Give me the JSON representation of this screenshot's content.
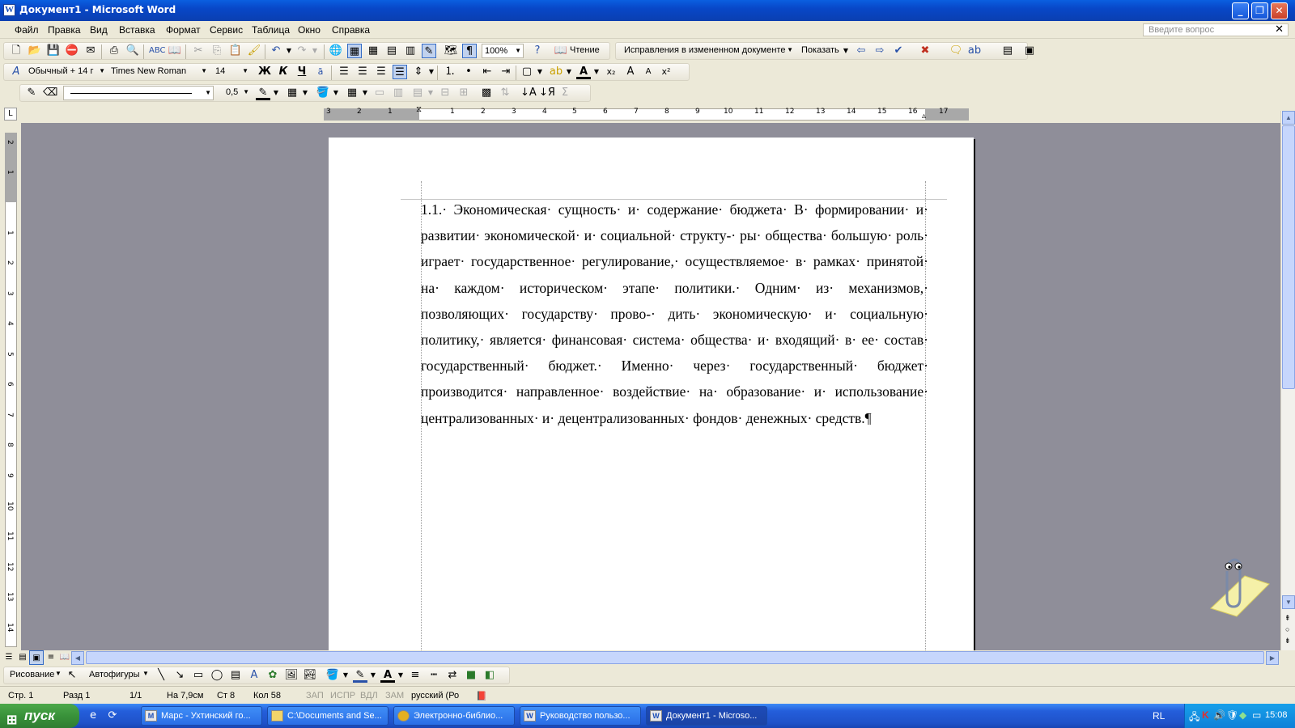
{
  "window": {
    "title": "Документ1 - Microsoft Word",
    "app_icon": "word-icon"
  },
  "menu": {
    "items": [
      "Файл",
      "Правка",
      "Вид",
      "Вставка",
      "Формат",
      "Сервис",
      "Таблица",
      "Окно",
      "Справка"
    ],
    "ask_placeholder": "Введите вопрос"
  },
  "toolbar": {
    "zoom": "100%",
    "reading": "Чтение",
    "track_changes": "Исправления в измененном документе",
    "show": "Показать"
  },
  "format_toolbar": {
    "style": "Обычный + 14 г",
    "font": "Times New Roman",
    "size": "14",
    "bold": "Ж",
    "italic": "К",
    "underline": "Ч"
  },
  "drawing_format_toolbar": {
    "line_width": "0,5"
  },
  "ruler": {
    "h_numbers": [
      "3",
      "2",
      "1",
      "1",
      "2",
      "3",
      "4",
      "5",
      "6",
      "7",
      "8",
      "9",
      "10",
      "11",
      "12",
      "13",
      "14",
      "15",
      "16",
      "17"
    ],
    "v_numbers": [
      "2",
      "1",
      "1",
      "2",
      "3",
      "4",
      "5",
      "6",
      "7",
      "8",
      "9",
      "10",
      "11",
      "12",
      "13",
      "14"
    ]
  },
  "document": {
    "text": "1.1.· Экономическая· сущность· и· содержание· бюджета· В· формировании· и· развитии· экономической· и· социальной· структу-· ры· общества· большую· роль· играет· государственное· регулирование,· осуществляемое· в· рамках· принятой· на· каждом· историческом· этапе· политики.· Одним· из· механизмов,· позволяющих· государству· прово-· дить· экономическую· и· социальную· политику,· является· финансовая· система· общества· и· входящий· в· ее· состав· государственный· бюджет.· Именно· через· государственный· бюджет· производится· направленное· воздействие· на· образование· и· использование· централизованных· и· децентрализованных· фондов· денежных· средств.¶"
  },
  "drawing_toolbar": {
    "drawing": "Рисование",
    "autoshapes": "Автофигуры"
  },
  "status": {
    "page": "Стр. 1",
    "section": "Разд 1",
    "pages": "1/1",
    "at": "На 7,9см",
    "line": "Ст 8",
    "col": "Кол 58",
    "rec": "ЗАП",
    "trk": "ИСПР",
    "ext": "ВДЛ",
    "ovr": "ЗАМ",
    "lang": "русский (Ро"
  },
  "taskbar": {
    "start": "пуск",
    "buttons": [
      {
        "label": "Марс - Ухтинский го...",
        "icon": "app-icon"
      },
      {
        "label": "C:\\Documents and Se...",
        "icon": "folder-icon"
      },
      {
        "label": "Электронно-библио...",
        "icon": "chrome-icon"
      },
      {
        "label": "Руководство пользо...",
        "icon": "word-icon"
      },
      {
        "label": "Документ1 - Microso...",
        "icon": "word-icon"
      }
    ],
    "lang": "RL",
    "clock": "15:08"
  },
  "colors": {
    "title_blue": "#0a50d8",
    "workspace_grey": "#8f8e99",
    "start_green": "#3a933a",
    "tray_blue": "#1190e0"
  }
}
